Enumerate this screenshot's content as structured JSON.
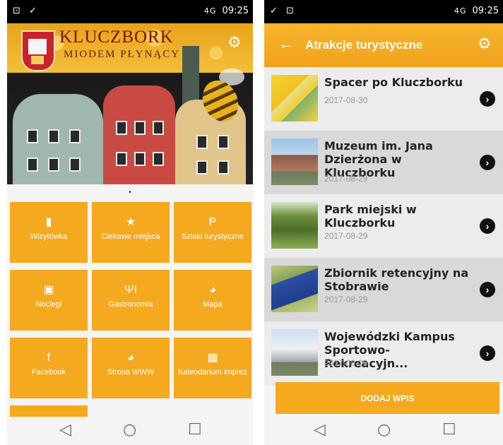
{
  "left_screen": {
    "status": {
      "left_icons": "⊡ ✓",
      "signal": "4G",
      "time": "09:25"
    },
    "header": {
      "title": "KLUCZBORK",
      "subtitle": "MIODEM PŁYNĄCY"
    },
    "carousel_indicator": "•",
    "tiles": [
      {
        "label": "Wizytówka",
        "icon": "bookmark-icon",
        "glyph": "▮"
      },
      {
        "label": "Ciekawe miejsca",
        "icon": "star-icon",
        "glyph": "★"
      },
      {
        "label": "Szlaki turystyczne",
        "icon": "signpost-icon",
        "glyph": "Ᵽ"
      },
      {
        "label": "Noclegi",
        "icon": "building-icon",
        "glyph": "▣"
      },
      {
        "label": "Gastronomia",
        "icon": "cutlery-icon",
        "glyph": "ΨΙ"
      },
      {
        "label": "Mapa",
        "icon": "globe-icon",
        "glyph": "◕"
      },
      {
        "label": "Facebook",
        "icon": "facebook-icon",
        "glyph": "f"
      },
      {
        "label": "Strona WWW",
        "icon": "globe-icon",
        "glyph": "◕"
      },
      {
        "label": "Kalendarium imprez",
        "icon": "calendar-icon",
        "glyph": "▦"
      }
    ],
    "nav": {
      "back": "◁",
      "home": "○",
      "recents": "☐"
    }
  },
  "right_screen": {
    "status": {
      "left_icons": "✓ ⊡",
      "signal": "4G",
      "time": "09:25"
    },
    "appbar": {
      "back_glyph": "←",
      "title": "Atrakcje turystyczne",
      "gear_glyph": "⚙"
    },
    "items": [
      {
        "title": "Spacer po Kluczborku",
        "date": "2017-08-30"
      },
      {
        "title": "Muzeum im. Jana Dzierżona w Kluczborku",
        "date": "2017-08-29"
      },
      {
        "title": "Park miejski w Kluczborku",
        "date": "2017-08-29"
      },
      {
        "title": "Zbiornik retencyjny na Stobrawie",
        "date": "2017-08-29"
      },
      {
        "title": "Wojewódzki Kampus Sportowo-Rekreacyjn...",
        "date": "2017-08-29"
      }
    ],
    "add_button": "DODAJ WPIS",
    "nav": {
      "back": "◁",
      "home": "○",
      "recents": "☐"
    }
  },
  "colors": {
    "accent": "#f4a91f",
    "accent_dark": "#e39214",
    "row_shaded": "#d9d9d9",
    "row_plain": "#ececec"
  }
}
